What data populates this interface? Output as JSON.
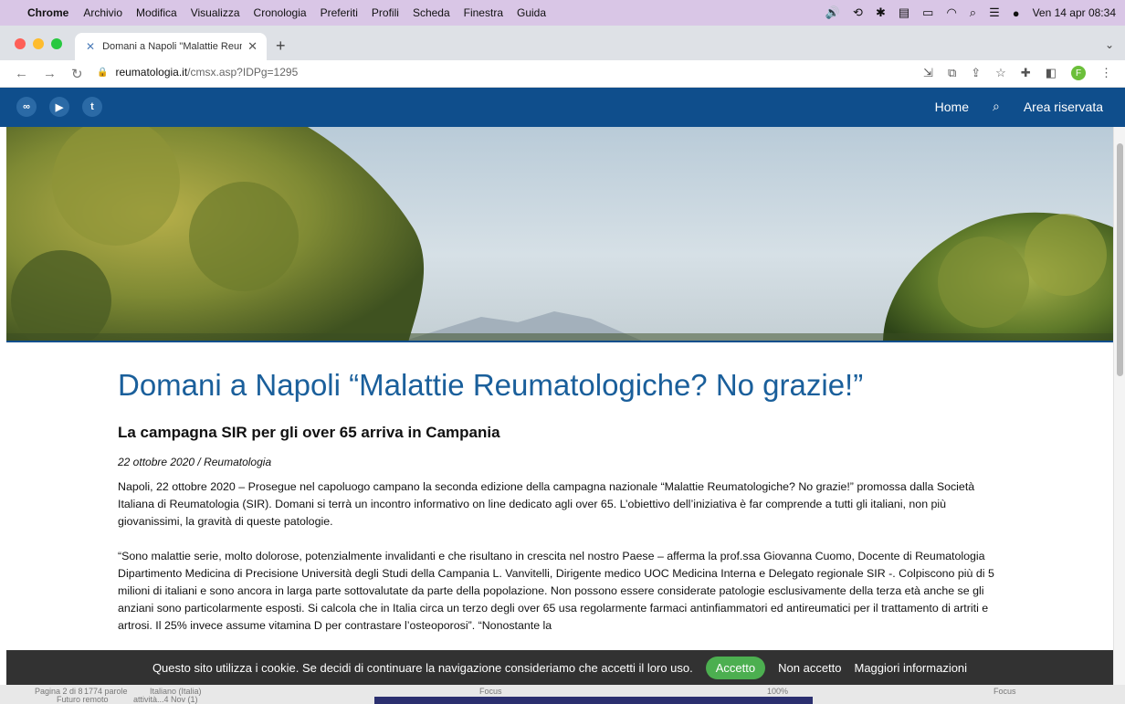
{
  "menubar": {
    "app_name": "Chrome",
    "items": [
      "Archivio",
      "Modifica",
      "Visualizza",
      "Cronologia",
      "Preferiti",
      "Profili",
      "Scheda",
      "Finestra",
      "Guida"
    ],
    "clock": "Ven 14 apr  08:34"
  },
  "browser": {
    "tab_title": "Domani a Napoli \"Malattie Reum",
    "url_domain": "reumatologia.it",
    "url_path": "/cmsx.asp?IDPg=1295",
    "profile_initial": "F"
  },
  "site": {
    "social": [
      "∞",
      "▶",
      "t"
    ],
    "nav": {
      "home": "Home",
      "reserved": "Area riservata"
    }
  },
  "article": {
    "title": "Domani a Napoli “Malattie Reumatologiche? No grazie!”",
    "subtitle": "La campagna SIR per gli over 65 arriva in Campania",
    "meta": "22 ottobre 2020 / Reumatologia",
    "paragraph1": "Napoli, 22 ottobre 2020 – Prosegue nel capoluogo campano la seconda edizione della campagna nazionale “Malattie Reumatologiche? No grazie!” promossa dalla Società Italiana di Reumatologia (SIR). Domani si terrà un incontro informativo on line dedicato agli over 65. L’obiettivo dell’iniziativa è far comprende a tutti gli italiani, non più giovanissimi, la gravità di queste patologie.",
    "paragraph2": "“Sono malattie serie, molto dolorose, potenzialmente invalidanti e che risultano in crescita nel nostro Paese – afferma la prof.ssa Giovanna Cuomo, Docente di Reumatologia Dipartimento Medicina di Precisione Università degli Studi della Campania L. Vanvitelli, Dirigente medico UOC Medicina Interna e Delegato regionale SIR -. Colpiscono più di 5 milioni di italiani e sono ancora in larga parte sottovalutate da parte della popolazione. Non possono essere considerate patologie esclusivamente della terza età anche se gli anziani sono particolarmente esposti. Si calcola che in Italia circa un terzo degli over 65 usa regolarmente farmaci antinfiammatori ed antireumatici per il trattamento di artriti e artrosi. Il 25% invece assume vitamina D per contrastare l’osteoporosi”. “Nonostante la"
  },
  "cookie": {
    "message": "Questo sito utilizza i cookie. Se decidi di continuare la navigazione consideriamo che accetti il loro uso.",
    "accept": "Accetto",
    "decline": "Non accetto",
    "more": "Maggiori informazioni"
  },
  "background_window": {
    "page": "Pagina 2 di 8",
    "words": "1774 parole",
    "language": "Italiano (Italia)",
    "focus": "Focus",
    "zoom": "100%",
    "snippet": "Futuro remoto",
    "snippet2": "attività...4 Nov (1)"
  },
  "colors": {
    "site_blue": "#0f4e8c",
    "title_blue": "#1a5f9b",
    "accept_green": "#4caf50",
    "menubar_bg": "#d9c6e6"
  }
}
